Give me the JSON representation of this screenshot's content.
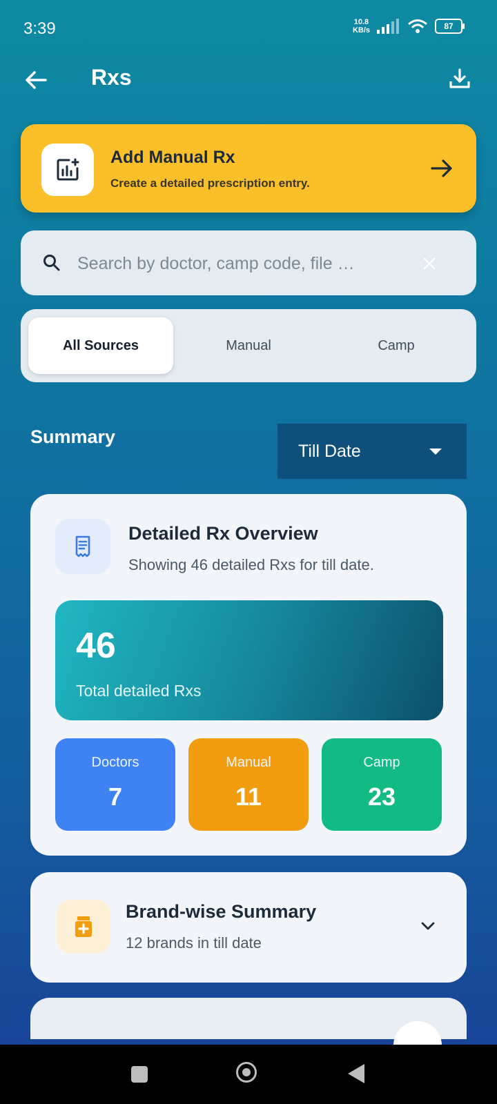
{
  "status_bar": {
    "time": "3:39",
    "net_speed_value": "10.8",
    "net_speed_unit": "KB/s",
    "battery": "87"
  },
  "header": {
    "title": "Rxs"
  },
  "add_manual": {
    "title": "Add Manual Rx",
    "subtitle": "Create a detailed prescription entry."
  },
  "search": {
    "placeholder": "Search by doctor, camp code, file …",
    "value": ""
  },
  "source_tabs": [
    {
      "label": "All Sources",
      "active": true
    },
    {
      "label": "Manual",
      "active": false
    },
    {
      "label": "Camp",
      "active": false
    }
  ],
  "summary": {
    "label": "Summary",
    "period_selected": "Till Date"
  },
  "overview": {
    "title": "Detailed Rx Overview",
    "subtitle": "Showing 46 detailed Rxs for till date.",
    "total_value": "46",
    "total_label": "Total detailed Rxs",
    "stats": [
      {
        "label": "Doctors",
        "value": "7",
        "color": "#3f82f3"
      },
      {
        "label": "Manual",
        "value": "11",
        "color": "#f29d10"
      },
      {
        "label": "Camp",
        "value": "23",
        "color": "#12bb84"
      }
    ]
  },
  "brand_summary": {
    "title": "Brand-wise Summary",
    "subtitle": "12 brands in till date"
  },
  "colors": {
    "accent": "#fbbf2a",
    "dropdown_bg": "#0f4f7c"
  }
}
